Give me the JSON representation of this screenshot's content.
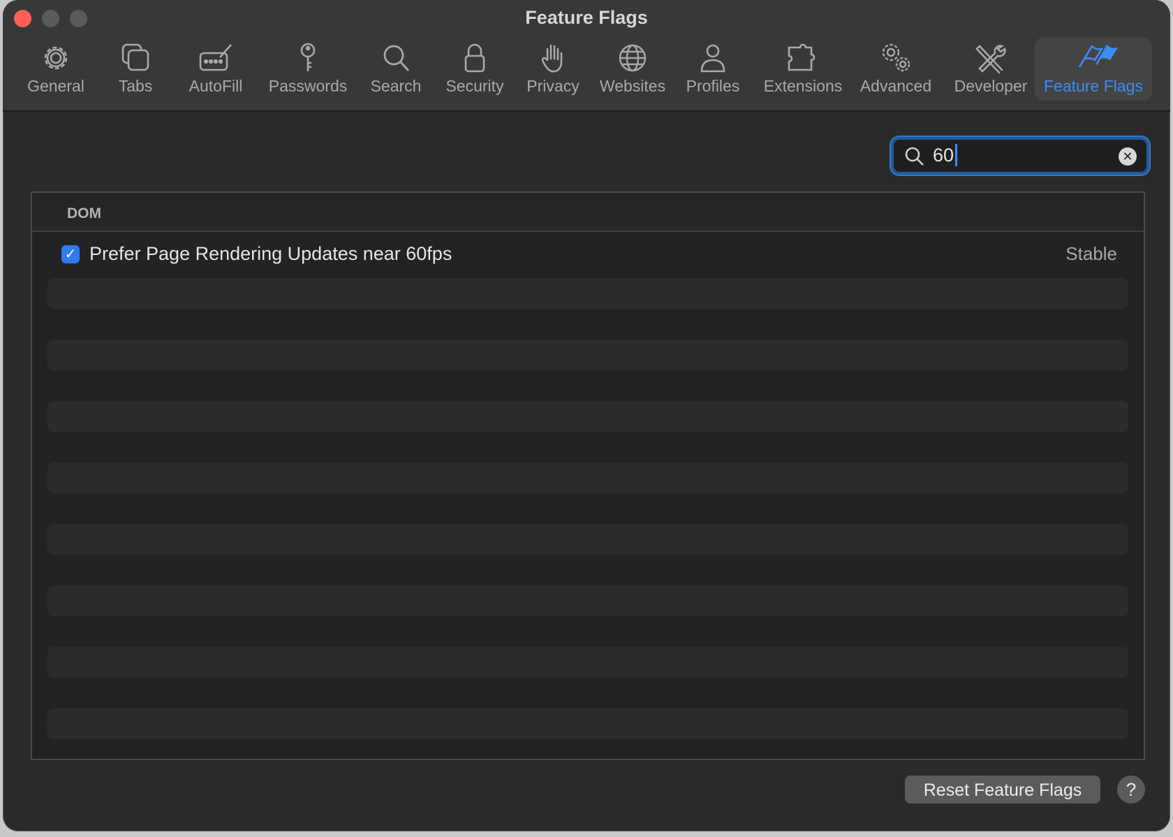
{
  "window": {
    "title": "Feature Flags"
  },
  "toolbar": {
    "items": [
      {
        "label": "General",
        "icon": "gear-icon"
      },
      {
        "label": "Tabs",
        "icon": "tabs-icon"
      },
      {
        "label": "AutoFill",
        "icon": "autofill-icon"
      },
      {
        "label": "Passwords",
        "icon": "key-icon"
      },
      {
        "label": "Search",
        "icon": "search-icon"
      },
      {
        "label": "Security",
        "icon": "lock-icon"
      },
      {
        "label": "Privacy",
        "icon": "hand-icon"
      },
      {
        "label": "Websites",
        "icon": "globe-icon"
      },
      {
        "label": "Profiles",
        "icon": "person-icon"
      },
      {
        "label": "Extensions",
        "icon": "puzzle-icon"
      },
      {
        "label": "Advanced",
        "icon": "gears-icon"
      },
      {
        "label": "Developer",
        "icon": "tools-icon"
      },
      {
        "label": "Feature Flags",
        "icon": "flags-icon",
        "active": true
      }
    ]
  },
  "search": {
    "value": "60"
  },
  "section": {
    "title": "DOM",
    "flags": [
      {
        "label": "Prefer Page Rendering Updates near 60fps",
        "status": "Stable",
        "checked": true
      }
    ]
  },
  "footer": {
    "reset_label": "Reset Feature Flags",
    "help_label": "?"
  },
  "colors": {
    "accent": "#3b8cf4",
    "close": "#ff5f57",
    "background": "#2a2a2a"
  }
}
